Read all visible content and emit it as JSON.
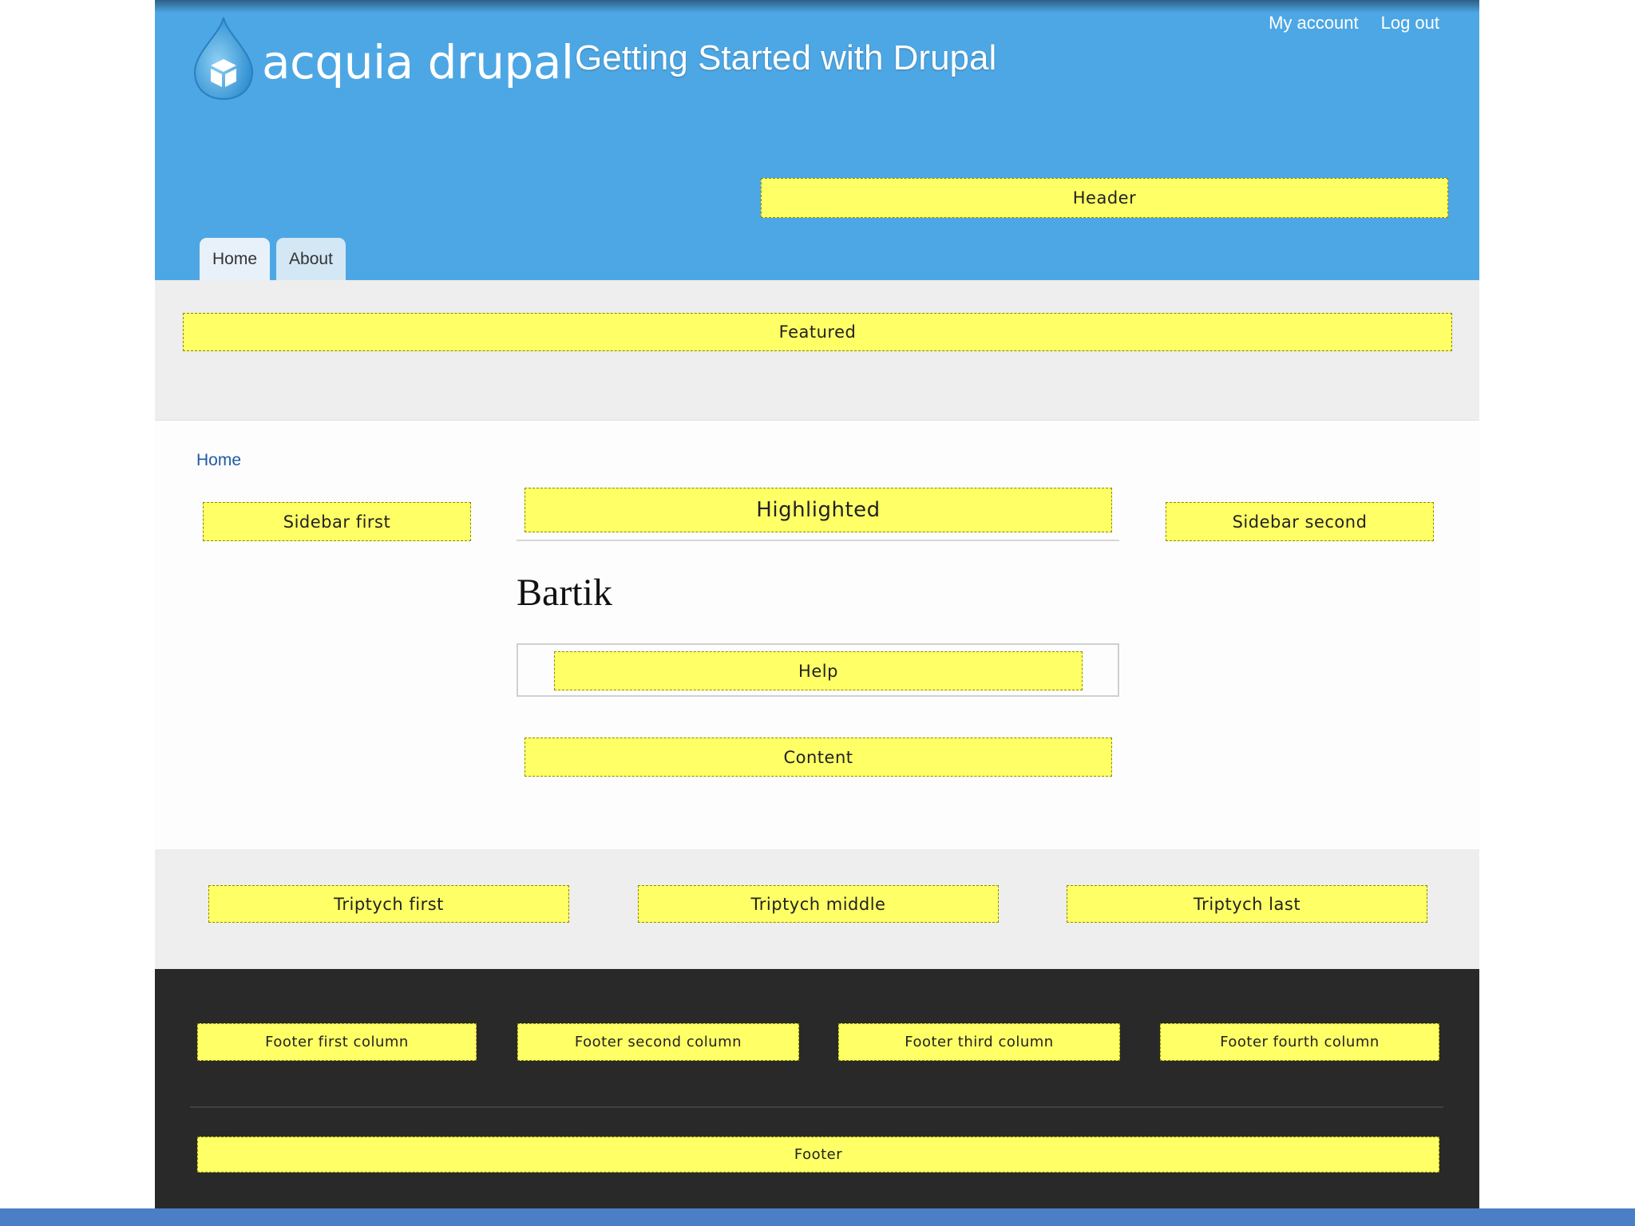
{
  "site": {
    "logo_text": "acquia drupal",
    "name": "Getting Started with Drupal"
  },
  "secondary_menu": {
    "my_account": "My account",
    "log_out": "Log out"
  },
  "main_menu": {
    "tabs": [
      {
        "label": "Home",
        "active": true
      },
      {
        "label": "About",
        "active": false
      }
    ]
  },
  "regions": {
    "header": "Header",
    "featured": "Featured",
    "sidebar_first": "Sidebar first",
    "highlighted": "Highlighted",
    "sidebar_second": "Sidebar second",
    "help": "Help",
    "content": "Content",
    "triptych_first": "Triptych first",
    "triptych_middle": "Triptych middle",
    "triptych_last": "Triptych last",
    "footer_first": "Footer first column",
    "footer_second": "Footer second column",
    "footer_third": "Footer third column",
    "footer_fourth": "Footer fourth column",
    "footer": "Footer"
  },
  "breadcrumb": "Home",
  "page_title": "Bartik",
  "colors": {
    "header_blue": "#4da7e4",
    "region_yellow": "#ffff66",
    "footer_dark": "#292929",
    "band_gray": "#eeeeee",
    "link_blue": "#1e5ba8"
  }
}
